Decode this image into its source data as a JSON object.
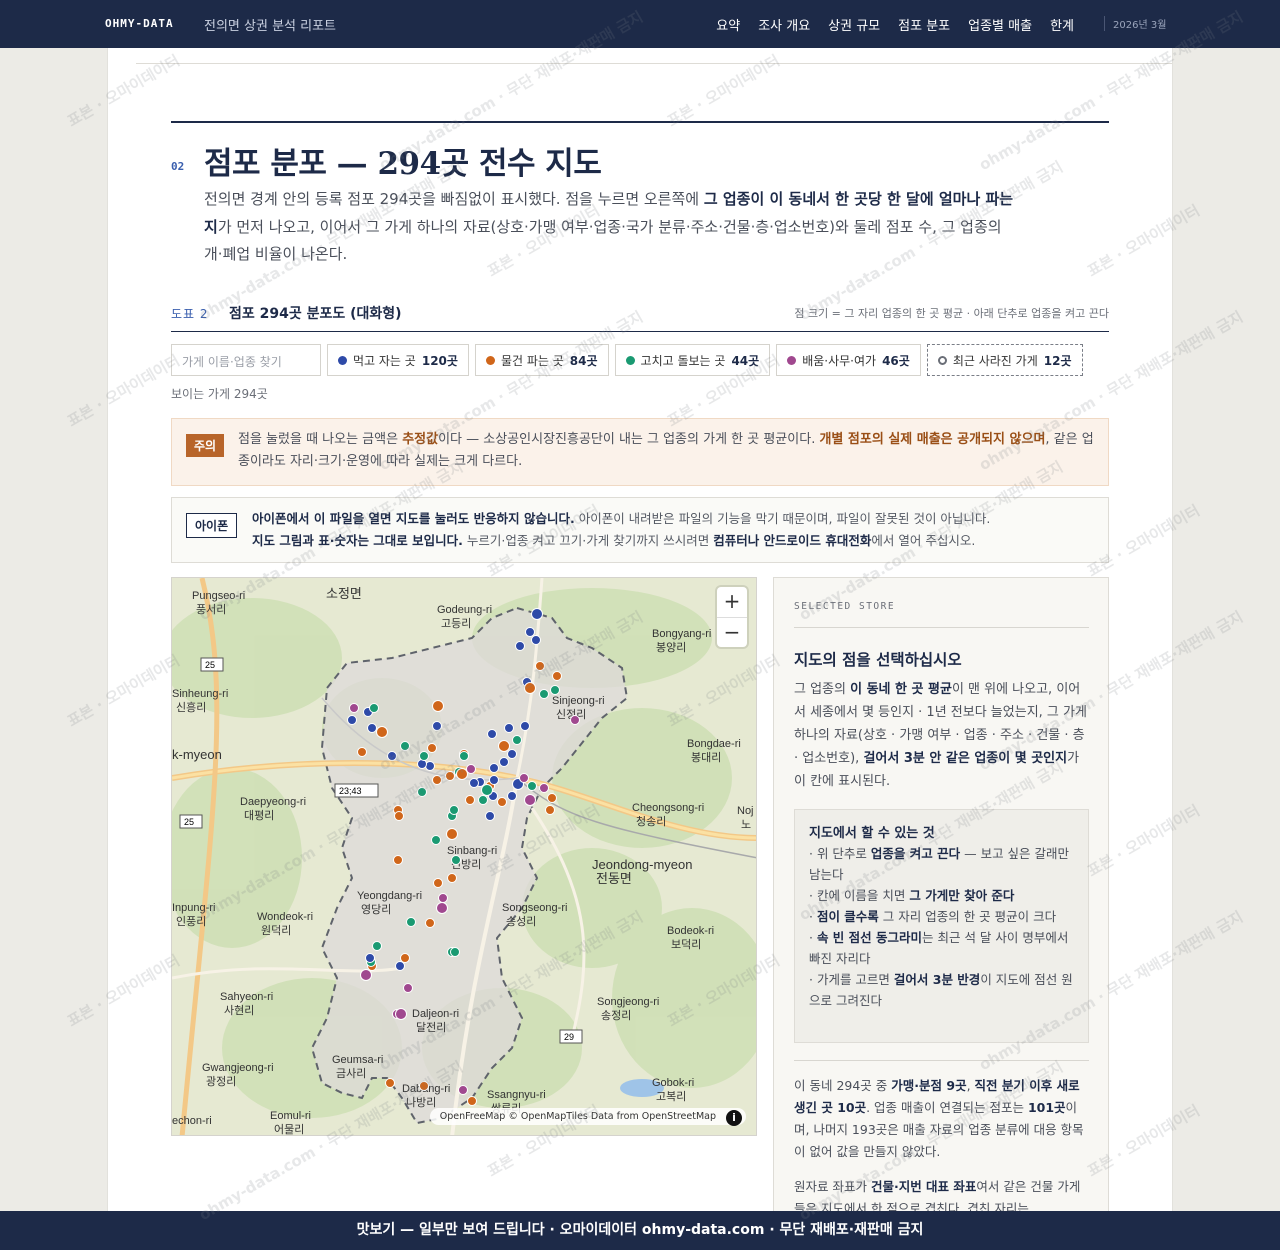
{
  "header": {
    "brand": "OHMY-DATA",
    "subtitle": "전의면 상권 분석 리포트",
    "nav": [
      "요약",
      "조사 개요",
      "상권 규모",
      "점포 분포",
      "업종별 매출",
      "한계"
    ],
    "date": "2026년 3월"
  },
  "section": {
    "number": "02",
    "title": "점포 분포 — 294곳 전수 지도",
    "lead_1": "전의면 경계 안의 등록 점포 294곳을 빠짐없이 표시했다. 점을 누르면 오른쪽에 ",
    "lead_bold": "그 업종이 이 동네서 한 곳당 한 달에 얼마나 파는지",
    "lead_2": "가 먼저 나오고, 이어서 그 가게 하나의 자료(상호·가맹 여부·업종·국가 분류·주소·건물·층·업소번호)와 둘레 점포 수, 그 업종의 개·폐업 비율이 나온다."
  },
  "figure": {
    "label": "도표 2",
    "title": "점포 294곳 분포도 (대화형)",
    "note": "점 크기 = 그 자리 업종의 한 곳 평균 · 아래 단추로 업종을 켜고 끈다"
  },
  "filters": {
    "search_placeholder": "가게 이름·업종 찾기",
    "chips": [
      {
        "label": "먹고 자는 곳",
        "count": "120곳",
        "color": "#2e4aa8"
      },
      {
        "label": "물건 파는 곳",
        "count": "84곳",
        "color": "#d0661a"
      },
      {
        "label": "고치고 돌보는 곳",
        "count": "44곳",
        "color": "#1a9a72"
      },
      {
        "label": "배움·사무·여가",
        "count": "46곳",
        "color": "#a0488f"
      },
      {
        "label": "최근 사라진 가게",
        "count": "12곳",
        "color": "#6a6e77"
      }
    ],
    "visible_count": "보이는 가게 294곳"
  },
  "alert": {
    "tag": "주의",
    "text_1": "점을 눌렀을 때 나오는 금액은 ",
    "text_bold1": "추정값",
    "text_2": "이다 — 소상공인시장진흥공단이 내는 그 업종의 가게 한 곳 평균이다. ",
    "text_bold2": "개별 점포의 실제 매출은 공개되지 않으며",
    "text_3": ", 같은 업종이라도 자리·크기·운영에 따라 실제는 크게 다르다."
  },
  "notice": {
    "tag": "아이폰",
    "bold1": "아이폰에서 이 파일을 열면 지도를 눌러도 반응하지 않습니다.",
    "text1": " 아이폰이 내려받은 파일의 기능을 막기 때문이며, 파일이 잘못된 것이 아닙니다.",
    "bold2": "지도 그림과 표·숫자는 그대로 보입니다.",
    "text2": " 누르기·업종 켜고 끄기·가게 찾기까지 쓰시려면 ",
    "bold3": "컴퓨터나 안드로이드 휴대전화",
    "text3": "에서 열어 주십시오."
  },
  "map": {
    "zoom_in": "+",
    "zoom_out": "−",
    "attribution": "OpenFreeMap © OpenMapTiles Data from OpenStreetMap",
    "info": "i",
    "places": [
      {
        "ko": "소정면",
        "en": ""
      },
      {
        "ko": "풍서리",
        "en": "Pungseo-ri"
      },
      {
        "ko": "고등리",
        "en": "Godeung-ri"
      },
      {
        "ko": "봉양리",
        "en": "Bongyang-ri"
      },
      {
        "ko": "신흥리",
        "en": "Sinheung-ri"
      },
      {
        "ko": "신정리",
        "en": "Sinjeong-ri"
      },
      {
        "ko": "봉대리",
        "en": "Bongdae-ri"
      },
      {
        "ko": "대평리",
        "en": "Daepyeong-ri"
      },
      {
        "ko": "청송리",
        "en": "Cheongsong-ri"
      },
      {
        "ko": "신방리",
        "en": "Sinbang-ri"
      },
      {
        "ko": "전동면",
        "en": "Jeondong-myeon"
      },
      {
        "ko": "영당리",
        "en": "Yeongdang-ri"
      },
      {
        "ko": "인풍리",
        "en": "Inpung-ri"
      },
      {
        "ko": "원덕리",
        "en": "Wondeok-ri"
      },
      {
        "ko": "송성리",
        "en": "Songseong-ri"
      },
      {
        "ko": "보덕리",
        "en": "Bodeok-ri"
      },
      {
        "ko": "사현리",
        "en": "Sahyeon-ri"
      },
      {
        "ko": "달전리",
        "en": "Daljeon-ri"
      },
      {
        "ko": "송정리",
        "en": "Songjeong-ri"
      },
      {
        "ko": "광정리",
        "en": "Gwangjeong-ri"
      },
      {
        "ko": "금사리",
        "en": "Geumsa-ri"
      },
      {
        "ko": "나방리",
        "en": "Dabang-ri"
      },
      {
        "ko": "고복리",
        "en": "Gobok-ri"
      },
      {
        "ko": "쌍류리",
        "en": "Ssangnyu-ri"
      },
      {
        "ko": "어물리",
        "en": "Eomul-ri"
      },
      {
        "ko": "",
        "en": "k-myeon"
      },
      {
        "ko": "",
        "en": "echon-ri"
      },
      {
        "ko": "노",
        "en": "Noj"
      }
    ],
    "route_shields": [
      "25",
      "25",
      "23;43",
      "29"
    ]
  },
  "panel": {
    "kicker": "SELECTED STORE",
    "title": "지도의 점을 선택하십시오",
    "body_1": "그 업종의 ",
    "body_b1": "이 동네 한 곳 평균",
    "body_2": "이 맨 위에 나오고, 이어서 세종에서 몇 등인지 · 1년 전보다 늘었는지, 그 가게 하나의 자료(상호 · 가맹 여부 · 업종 · 주소 · 건물 · 층 · 업소번호), ",
    "body_b2": "걸어서 3분 안 같은 업종이 몇 곳인지",
    "body_3": "가 이 칸에 표시된다.",
    "howto_title": "지도에서 할 수 있는 것",
    "howto": [
      {
        "pre": "· 위 단추로 ",
        "b": "업종을 켜고 끈다",
        "post": " — 보고 싶은 갈래만 남는다"
      },
      {
        "pre": "· 칸에 이름을 치면 ",
        "b": "그 가게만 찾아 준다",
        "post": ""
      },
      {
        "pre": "· ",
        "b": "점이 클수록",
        "post": " 그 자리 업종의 한 곳 평균이 크다"
      },
      {
        "pre": "· ",
        "b": "속 빈 점선 동그라미",
        "post": "는 최근 석 달 사이 명부에서 빠진 자리다"
      },
      {
        "pre": "· 가게를 고르면 ",
        "b": "걸어서 3분 반경",
        "post": "이 지도에 점선 원으로 그려진다"
      }
    ],
    "stats_1": "이 동네 294곳 중 ",
    "stats_b1": "가맹·분점 9곳",
    "stats_2": ", ",
    "stats_b2": "직전 분기 이후 새로 생긴 곳 10곳",
    "stats_3": ". 업종 매출이 연결되는 점포는 ",
    "stats_b3": "101곳",
    "stats_4": "이며, 나머지 193곳은 매출 자료의 업종 분류에 대응 항목이 없어 값을 만들지 않았다.",
    "stats2_1": "원자료 좌표가 ",
    "stats2_b1": "건물·지번 대표 좌표",
    "stats2_2": "여서 같은 건물 가게들은 지도에서 한 점으로 겹친다. 겹친 자리는"
  },
  "footer": "맛보기 — 일부만 보여 드립니다 · 오마이데이터 ohmy-data.com · 무단 재배포·재판매 금지",
  "watermark": {
    "a": "표본 · 오마이데이터",
    "b": "ohmy-data.com · 무단 재배포·재판매 금지"
  }
}
